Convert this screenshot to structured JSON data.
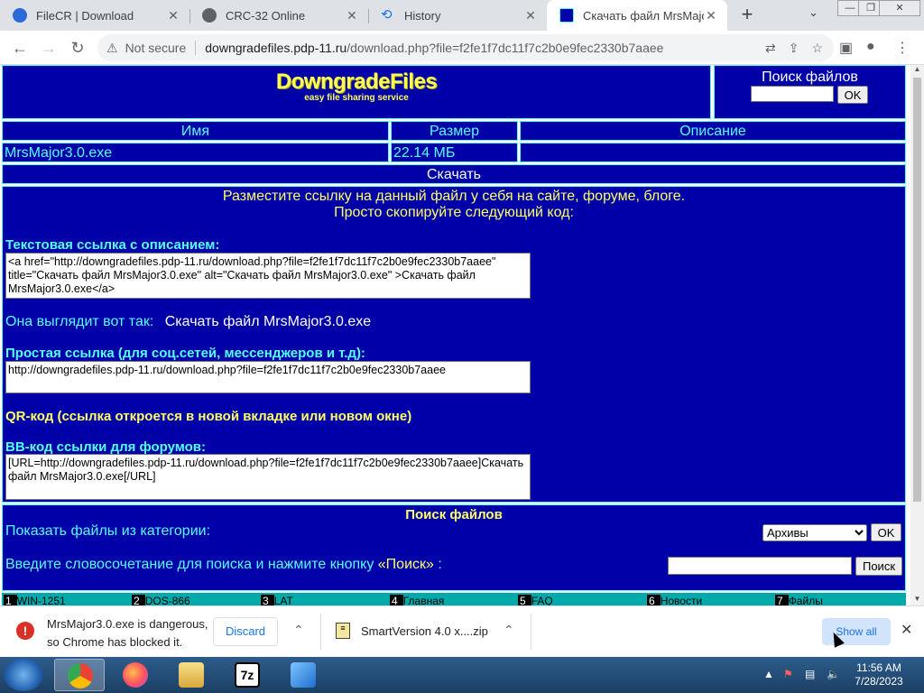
{
  "browser": {
    "tabs": [
      {
        "title": "FileCR | Download",
        "active": false
      },
      {
        "title": "CRC-32 Online",
        "active": false
      },
      {
        "title": "History",
        "active": false
      },
      {
        "title": "Скачать файл MrsMajor3",
        "active": true
      }
    ],
    "not_secure": "Not secure",
    "url_host": "downgradefiles.pdp-11.ru",
    "url_path": "/download.php?file=f2fe1f7dc11f7c2b0e9fec2330b7aaee"
  },
  "site": {
    "logo": "DowngradeFiles",
    "tagline": "easy file sharing service",
    "search_title": "Поиск файлов",
    "ok_label": "OK"
  },
  "file_table": {
    "headers": [
      "Имя",
      "Размер",
      "Описание"
    ],
    "name": "MrsMajor3.0.exe",
    "size": "22.14 МБ",
    "description": "",
    "download_label": "Скачать"
  },
  "share": {
    "intro_line1": "Разместите ссылку на данный файл у себя на сайте, форуме, блоге.",
    "intro_line2": "Просто скопируйте следующий код:",
    "text_link_label": "Текстовая ссылка с описанием:",
    "text_link_code": "<a href=\"http://downgradefiles.pdp-11.ru/download.php?file=f2fe1f7dc11f7c2b0e9fec2330b7aaee\" title=\"Скачать файл MrsMajor3.0.exe\" alt=\"Скачать файл MrsMajor3.0.exe\" >Скачать файл MrsMajor3.0.exe</a>",
    "looks_like_label": "Она выглядит вот так:",
    "looks_like_link": "Скачать файл MrsMajor3.0.exe",
    "simple_link_label": "Простая ссылка (для соц.сетей, мессенджеров и т.д):",
    "simple_link_code": "http://downgradefiles.pdp-11.ru/download.php?file=f2fe1f7dc11f7c2b0e9fec2330b7aaee",
    "qr_label": "QR-код (ссылка откроется в новой вкладке или новом окне)",
    "bb_label": "BB-код ссылки для форумов:",
    "bb_code": "[URL=http://downgradefiles.pdp-11.ru/download.php?file=f2fe1f7dc11f7c2b0e9fec2330b7aaee]Скачать файл MrsMajor3.0.exe[/URL]"
  },
  "file_search": {
    "title": "Поиск файлов",
    "category_label": "Показать файлы из категории:",
    "category_selected": "Архивы",
    "ok_label": "OK",
    "query_label_prefix": "Введите словосочетание для поиска и нажмите кнопку ",
    "query_label_button": "«Поиск»",
    "query_label_suffix": " :",
    "search_button": "Поиск"
  },
  "bottom_menu": [
    {
      "num": "1",
      "label": "WIN-1251"
    },
    {
      "num": "2",
      "label": "DOS-866"
    },
    {
      "num": "3",
      "label": "LAT"
    },
    {
      "num": "4",
      "label": "Главная"
    },
    {
      "num": "5",
      "label": "FAQ"
    },
    {
      "num": "6",
      "label": "Новости"
    },
    {
      "num": "7",
      "label": "Файлы"
    }
  ],
  "downloads": {
    "blocked_line1": "MrsMajor3.0.exe is dangerous,",
    "blocked_line2": "so Chrome has blocked it.",
    "discard": "Discard",
    "second_file": "SmartVersion 4.0 x....zip",
    "show_all": "Show all"
  },
  "taskbar": {
    "time": "11:56 AM",
    "date": "7/28/2023"
  },
  "colors": {
    "page_bg": "#0000a8",
    "border": "#55ffff",
    "accent_yellow": "#ffff55",
    "menu_bar": "#00aaaa"
  }
}
